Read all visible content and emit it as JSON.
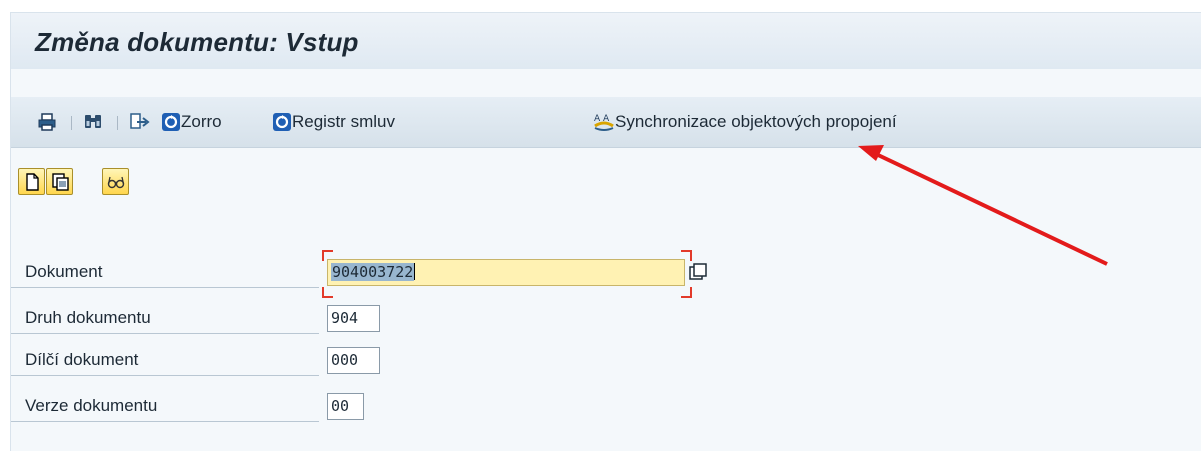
{
  "title": "Změna dokumentu: Vstup",
  "toolbar": {
    "buttons": [
      {
        "icon": "print-icon",
        "label": ""
      },
      {
        "icon": "find-icon",
        "label": ""
      },
      {
        "icon": "other-object-icon",
        "label": ""
      },
      {
        "icon": "sap-refresh-icon",
        "label": "Zorro"
      },
      {
        "icon": "sap-refresh-icon",
        "label": "Registr smluv"
      },
      {
        "icon": "sync-icon",
        "label": "Synchronizace objektových propojení"
      }
    ]
  },
  "app_buttons": [
    "new-document-icon",
    "copy-document-icon",
    "glasses-icon"
  ],
  "form": {
    "dokument": {
      "label": "Dokument",
      "value": "904003722"
    },
    "druh": {
      "label": "Druh dokumentu",
      "value": "904"
    },
    "dilci": {
      "label": "Dílčí dokument",
      "value": "000"
    },
    "verze": {
      "label": "Verze dokumentu",
      "value": "00"
    }
  },
  "colors": {
    "title_bg": "#dfe9f2",
    "toolbar_bg": "#d6e1ea",
    "active_field": "#fff2b3",
    "highlight_bracket": "#e23a2a",
    "annotation_arrow": "#e31b1b"
  }
}
